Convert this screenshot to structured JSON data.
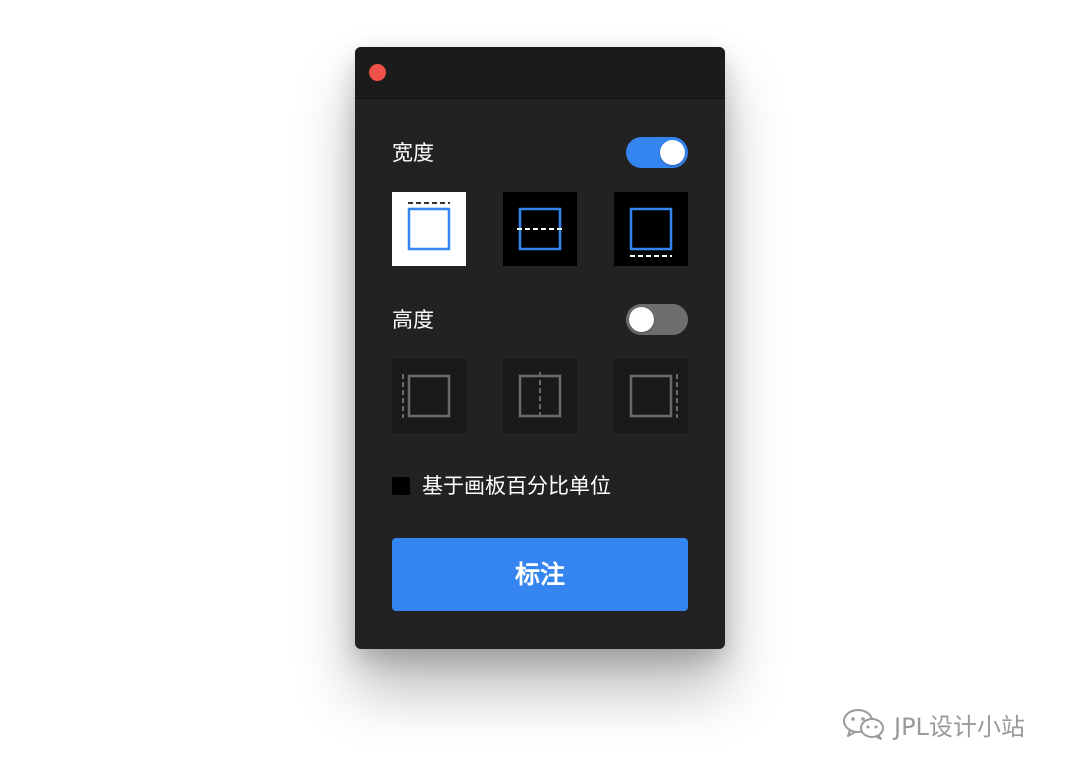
{
  "panel": {
    "width_section": {
      "label": "宽度",
      "toggle_on": true,
      "options": [
        {
          "icon": "width-top-icon",
          "selected": true
        },
        {
          "icon": "width-middle-icon",
          "selected": false
        },
        {
          "icon": "width-bottom-icon",
          "selected": false
        }
      ]
    },
    "height_section": {
      "label": "高度",
      "toggle_on": false,
      "options": [
        {
          "icon": "height-left-icon",
          "enabled": false
        },
        {
          "icon": "height-center-icon",
          "enabled": false
        },
        {
          "icon": "height-right-icon",
          "enabled": false
        }
      ]
    },
    "percent_checkbox": {
      "label": "基于画板百分比单位",
      "checked": false
    },
    "annotate_button": {
      "label": "标注"
    }
  },
  "watermark": {
    "text": "JPL设计小站",
    "icon": "wechat-icon"
  },
  "colors": {
    "accent": "#3485f0",
    "close": "#f0504a",
    "panel_bg": "#222222",
    "titlebar_bg": "#1b1b1b"
  }
}
